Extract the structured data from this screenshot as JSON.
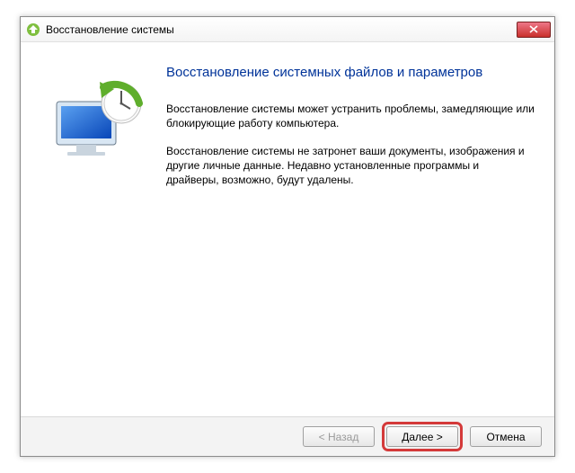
{
  "window": {
    "title": "Восстановление системы"
  },
  "header": {
    "heading": "Восстановление системных файлов и параметров"
  },
  "body": {
    "paragraph1": "Восстановление системы может устранить проблемы, замедляющие или блокирующие работу компьютера.",
    "paragraph2": "Восстановление системы не затронет ваши документы, изображения и другие личные данные. Недавно установленные программы и драйверы, возможно, будут удалены."
  },
  "buttons": {
    "back": "< Назад",
    "next": "Далее >",
    "cancel": "Отмена"
  }
}
